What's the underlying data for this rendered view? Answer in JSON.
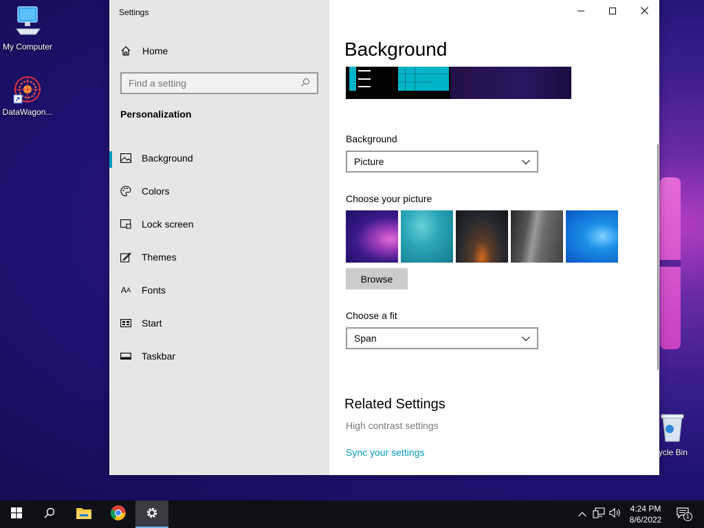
{
  "desktop": {
    "icons": [
      {
        "label": "My Computer"
      },
      {
        "label": "DataWagon..."
      },
      {
        "label": "cycle Bin"
      }
    ]
  },
  "window": {
    "title": "Settings",
    "controls": {
      "minimize": "minimize-icon",
      "maximize": "maximize-icon",
      "close": "close-icon"
    }
  },
  "sidebar": {
    "home_label": "Home",
    "search_placeholder": "Find a setting",
    "section_heading": "Personalization",
    "items": [
      {
        "label": "Background",
        "icon": "picture-icon",
        "active": true
      },
      {
        "label": "Colors",
        "icon": "palette-icon"
      },
      {
        "label": "Lock screen",
        "icon": "lock-screen-icon"
      },
      {
        "label": "Themes",
        "icon": "brush-icon"
      },
      {
        "label": "Fonts",
        "icon": "fonts-icon"
      },
      {
        "label": "Start",
        "icon": "start-icon"
      },
      {
        "label": "Taskbar",
        "icon": "taskbar-icon"
      }
    ]
  },
  "main": {
    "page_title": "Background",
    "background_label": "Background",
    "background_value": "Picture",
    "choose_picture_label": "Choose your picture",
    "browse_label": "Browse",
    "fit_label": "Choose a fit",
    "fit_value": "Span",
    "related_heading": "Related Settings",
    "high_contrast_link": "High contrast settings",
    "sync_link": "Sync your settings",
    "accent_color": "#0099bc"
  },
  "taskbar": {
    "time": "4:24 PM",
    "date": "8/6/2022",
    "notification_count": "1"
  }
}
